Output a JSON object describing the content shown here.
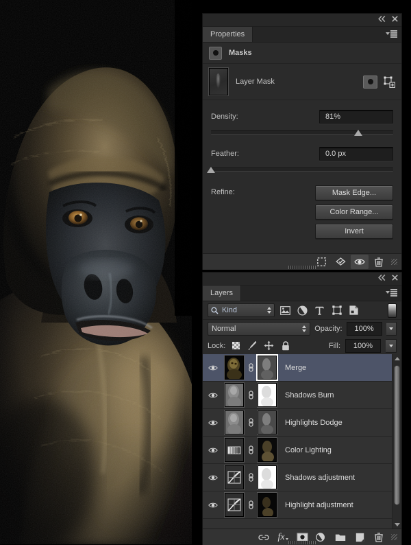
{
  "app": "Adobe Photoshop",
  "canvas": {
    "subject": "gorilla-portrait-photo"
  },
  "properties_panel": {
    "tab_label": "Properties",
    "collapse_icon": "collapse-double-chevron-icon",
    "close_icon": "close-icon",
    "menu_icon": "panel-menu-icon",
    "section_title": "Masks",
    "mask_row_label": "Layer Mask",
    "pixel_mask_icon": "pixel-mask-icon",
    "vector_mask_icon": "vector-mask-icon",
    "density": {
      "label": "Density:",
      "value": "81%",
      "percent": 81
    },
    "feather": {
      "label": "Feather:",
      "value": "0.0 px",
      "percent": 0
    },
    "refine": {
      "label": "Refine:",
      "buttons": [
        "Mask Edge...",
        "Color Range...",
        "Invert"
      ]
    },
    "footer_icons": [
      "load-selection-from-mask-icon",
      "apply-mask-icon",
      "toggle-mask-visibility-icon",
      "delete-mask-icon"
    ]
  },
  "layers_panel": {
    "tab_label": "Layers",
    "collapse_icon": "collapse-double-chevron-icon",
    "close_icon": "close-icon",
    "menu_icon": "panel-menu-icon",
    "filter": {
      "kind_label": "Kind",
      "search_icon": "search-icon",
      "type_icons": [
        "filter-pixel-layers-icon",
        "filter-adjustment-layers-icon",
        "filter-type-layers-icon",
        "filter-shape-layers-icon",
        "filter-smart-object-icon"
      ],
      "toggle_icon": "filter-enable-toggle"
    },
    "blend_mode": "Normal",
    "opacity": {
      "label": "Opacity:",
      "value": "100%"
    },
    "fill": {
      "label": "Fill:",
      "value": "100%"
    },
    "lock": {
      "label": "Lock:",
      "icons": [
        "lock-transparent-pixels-icon",
        "lock-image-pixels-icon",
        "lock-position-icon",
        "lock-all-icon"
      ]
    },
    "layers": [
      {
        "name": "Merge",
        "visible": true,
        "selected": true,
        "thumb": "photo",
        "mask": "gray-mask",
        "linked": true
      },
      {
        "name": "Shadows Burn",
        "visible": true,
        "selected": false,
        "thumb": "gray-photo",
        "mask": "white-mask",
        "linked": true
      },
      {
        "name": "Highlights Dodge",
        "visible": true,
        "selected": false,
        "thumb": "gray-photo",
        "mask": "gray-mask",
        "linked": true
      },
      {
        "name": "Color Lighting",
        "visible": true,
        "selected": false,
        "thumb": "gradient-map-adjustment",
        "mask": "photo-mask",
        "linked": true
      },
      {
        "name": "Shadows adjustment",
        "visible": true,
        "selected": false,
        "thumb": "curves-adjustment",
        "mask": "white-mask",
        "linked": true
      },
      {
        "name": "Highlight adjustment",
        "visible": true,
        "selected": false,
        "thumb": "curves-adjustment",
        "mask": "dark-photo-mask",
        "linked": true
      }
    ],
    "footer_icons": [
      "link-layers-icon",
      "layer-style-fx-icon",
      "add-layer-mask-icon",
      "new-adjustment-layer-icon",
      "new-group-icon",
      "new-layer-icon",
      "delete-layer-icon"
    ]
  },
  "colors": {
    "panel_bg": "#2b2b2b",
    "panel_chrome": "#333333",
    "selection": "#4d5468",
    "text": "#cfcfcf",
    "accent_text": "#b8c4d8"
  }
}
